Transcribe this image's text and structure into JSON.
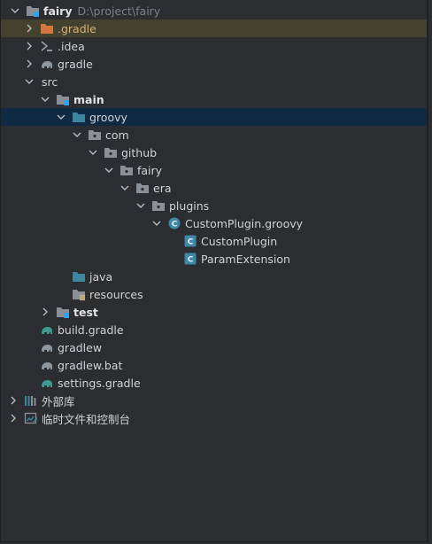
{
  "project": {
    "name": "fairy",
    "path": "D:\\project\\fairy"
  },
  "tree": [
    {
      "label": ".gradle",
      "icon": "folder-orange-icon",
      "level": 1,
      "chevron": "right"
    },
    {
      "label": ".idea",
      "icon": "idea-folder-icon",
      "level": 1,
      "chevron": "right"
    },
    {
      "label": "gradle",
      "icon": "gradle-elephant-icon",
      "level": 1,
      "chevron": "right"
    },
    {
      "label": "src",
      "icon": "none",
      "level": 1,
      "chevron": "down"
    },
    {
      "label": "main",
      "icon": "module-folder-icon",
      "level": 2,
      "chevron": "down"
    },
    {
      "label": "groovy",
      "icon": "source-folder-icon",
      "level": 3,
      "chevron": "down"
    },
    {
      "label": "com",
      "icon": "package-icon",
      "level": 4,
      "chevron": "down"
    },
    {
      "label": "github",
      "icon": "package-icon",
      "level": 5,
      "chevron": "down"
    },
    {
      "label": "fairy",
      "icon": "package-icon",
      "level": 6,
      "chevron": "down"
    },
    {
      "label": "era",
      "icon": "package-icon",
      "level": 7,
      "chevron": "down"
    },
    {
      "label": "plugins",
      "icon": "package-icon",
      "level": 8,
      "chevron": "down"
    },
    {
      "label": "CustomPlugin.groovy",
      "icon": "groovy-file-icon",
      "level": 9,
      "chevron": "down"
    },
    {
      "label": "CustomPlugin",
      "icon": "class-icon",
      "level": 10,
      "chevron": "none"
    },
    {
      "label": "ParamExtension",
      "icon": "class-icon",
      "level": 10,
      "chevron": "none"
    },
    {
      "label": "java",
      "icon": "source-folder-icon",
      "level": 3,
      "chevron": "none"
    },
    {
      "label": "resources",
      "icon": "resources-folder-icon",
      "level": 3,
      "chevron": "none"
    },
    {
      "label": "test",
      "icon": "module-folder-icon",
      "level": 2,
      "chevron": "right"
    },
    {
      "label": "build.gradle",
      "icon": "gradle-elephant-icon",
      "level": 1,
      "chevron": "none"
    },
    {
      "label": "gradlew",
      "icon": "gradle-elephant-icon",
      "level": 1,
      "chevron": "none"
    },
    {
      "label": "gradlew.bat",
      "icon": "gradle-elephant-icon",
      "level": 1,
      "chevron": "none"
    },
    {
      "label": "settings.gradle",
      "icon": "gradle-elephant-icon",
      "level": 1,
      "chevron": "none"
    },
    {
      "label": "外部库",
      "icon": "libraries-icon",
      "level": 0,
      "chevron": "right"
    },
    {
      "label": "临时文件和控制台",
      "icon": "scratches-icon",
      "level": 0,
      "chevron": "right"
    }
  ],
  "colors": {
    "background": "#2b2d30",
    "selected_row": "#0f2b43",
    "gradle_highlight_row": "#45412f",
    "folder_orange": "#d3773f",
    "source_folder_blue": "#3e86a0",
    "class_icon": "#3d87a9"
  }
}
